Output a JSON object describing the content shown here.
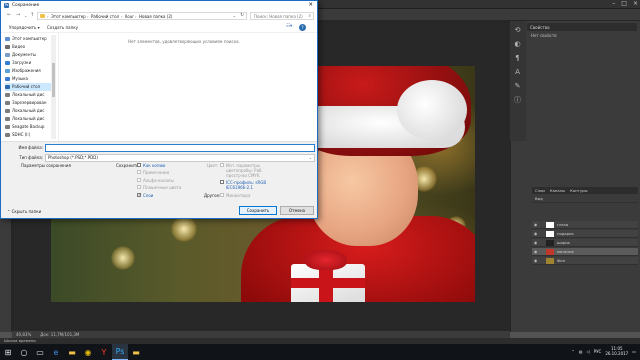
{
  "dialog": {
    "title": "Сохранение",
    "breadcrumbs": [
      "Этот компьютер",
      "Рабочий стол",
      "Ilour",
      "Новая папка (2)"
    ],
    "search_placeholder": "Поиск: Новая папка (2)",
    "organize_label": "Упорядочить ▾",
    "new_folder_label": "Создать папку",
    "empty_message": "Нет элементов, удовлетворяющих условиям поиска.",
    "nav_items": [
      {
        "label": "Этот компьютер",
        "icon": "computer-icon",
        "color": "#5b8fcf"
      },
      {
        "label": "Видео",
        "icon": "video-icon",
        "color": "#6b6b6b"
      },
      {
        "label": "Документы",
        "icon": "documents-icon",
        "color": "#7a9cc6"
      },
      {
        "label": "Загрузки",
        "icon": "downloads-icon",
        "color": "#2f7fd6"
      },
      {
        "label": "Изображения",
        "icon": "pictures-icon",
        "color": "#5aa0d8"
      },
      {
        "label": "Музыка",
        "icon": "music-icon",
        "color": "#3a7bd5"
      },
      {
        "label": "Рабочий стол",
        "icon": "desktop-icon",
        "color": "#2b6cb0",
        "selected": true
      },
      {
        "label": "Локальный дис",
        "icon": "drive-icon",
        "color": "#7d7d7d"
      },
      {
        "label": "Зарезервирован",
        "icon": "drive-icon",
        "color": "#7d7d7d"
      },
      {
        "label": "Локальный дис",
        "icon": "drive-icon",
        "color": "#7d7d7d"
      },
      {
        "label": "Локальный дис",
        "icon": "drive-icon",
        "color": "#7d7d7d"
      },
      {
        "label": "Seagate Backup",
        "icon": "drive-icon",
        "color": "#7d7d7d"
      },
      {
        "label": "SDHC (I:)",
        "icon": "sd-card-icon",
        "color": "#7d7d7d"
      }
    ],
    "filename_label": "Имя файла:",
    "filename_value": "",
    "filetype_label": "Тип файла:",
    "filetype_value": "Photoshop (*.PSD;*.PDD)",
    "params_label": "Параметры сохранения",
    "save_label": "Сохранить:",
    "options": {
      "as_copy": "Как копию",
      "notes": "Примечания",
      "alpha": "Альфа-каналы",
      "spot": "Плашечные цвета",
      "layers": "Слои"
    },
    "color_label": "Цвет:",
    "proof_text_1": "Исп. параметры",
    "proof_text_2": "цветопробы: Раб.",
    "proof_text_3": "простр-во CMYK",
    "icc_text_1": "ICC-профиль: sRGB",
    "icc_text_2": "IEC61966-2.1",
    "other_label": "Другое:",
    "thumbnail_label": "Миниатюра",
    "hide_folders_label": "Скрыть папки",
    "save_button": "Сохранить",
    "cancel_button": "Отмена"
  },
  "photoshop": {
    "properties_title": "Свойства",
    "properties_body": "Нет свойств",
    "layers_tabs": [
      "Слои",
      "Каналы",
      "Контуры"
    ],
    "layers_kind": "Вид",
    "layers": [
      {
        "name": "глаза"
      },
      {
        "name": "подарок"
      },
      {
        "name": "шарик"
      },
      {
        "name": "мальчик",
        "active": true
      },
      {
        "name": "Фон"
      }
    ],
    "status_zoom": "40,83%",
    "status_doc": "Док: 11,7M/101,3M",
    "timeline_label": "Шкала времени"
  },
  "taskbar": {
    "time": "11:05",
    "date": "26.10.2017",
    "lang": "РУС"
  }
}
